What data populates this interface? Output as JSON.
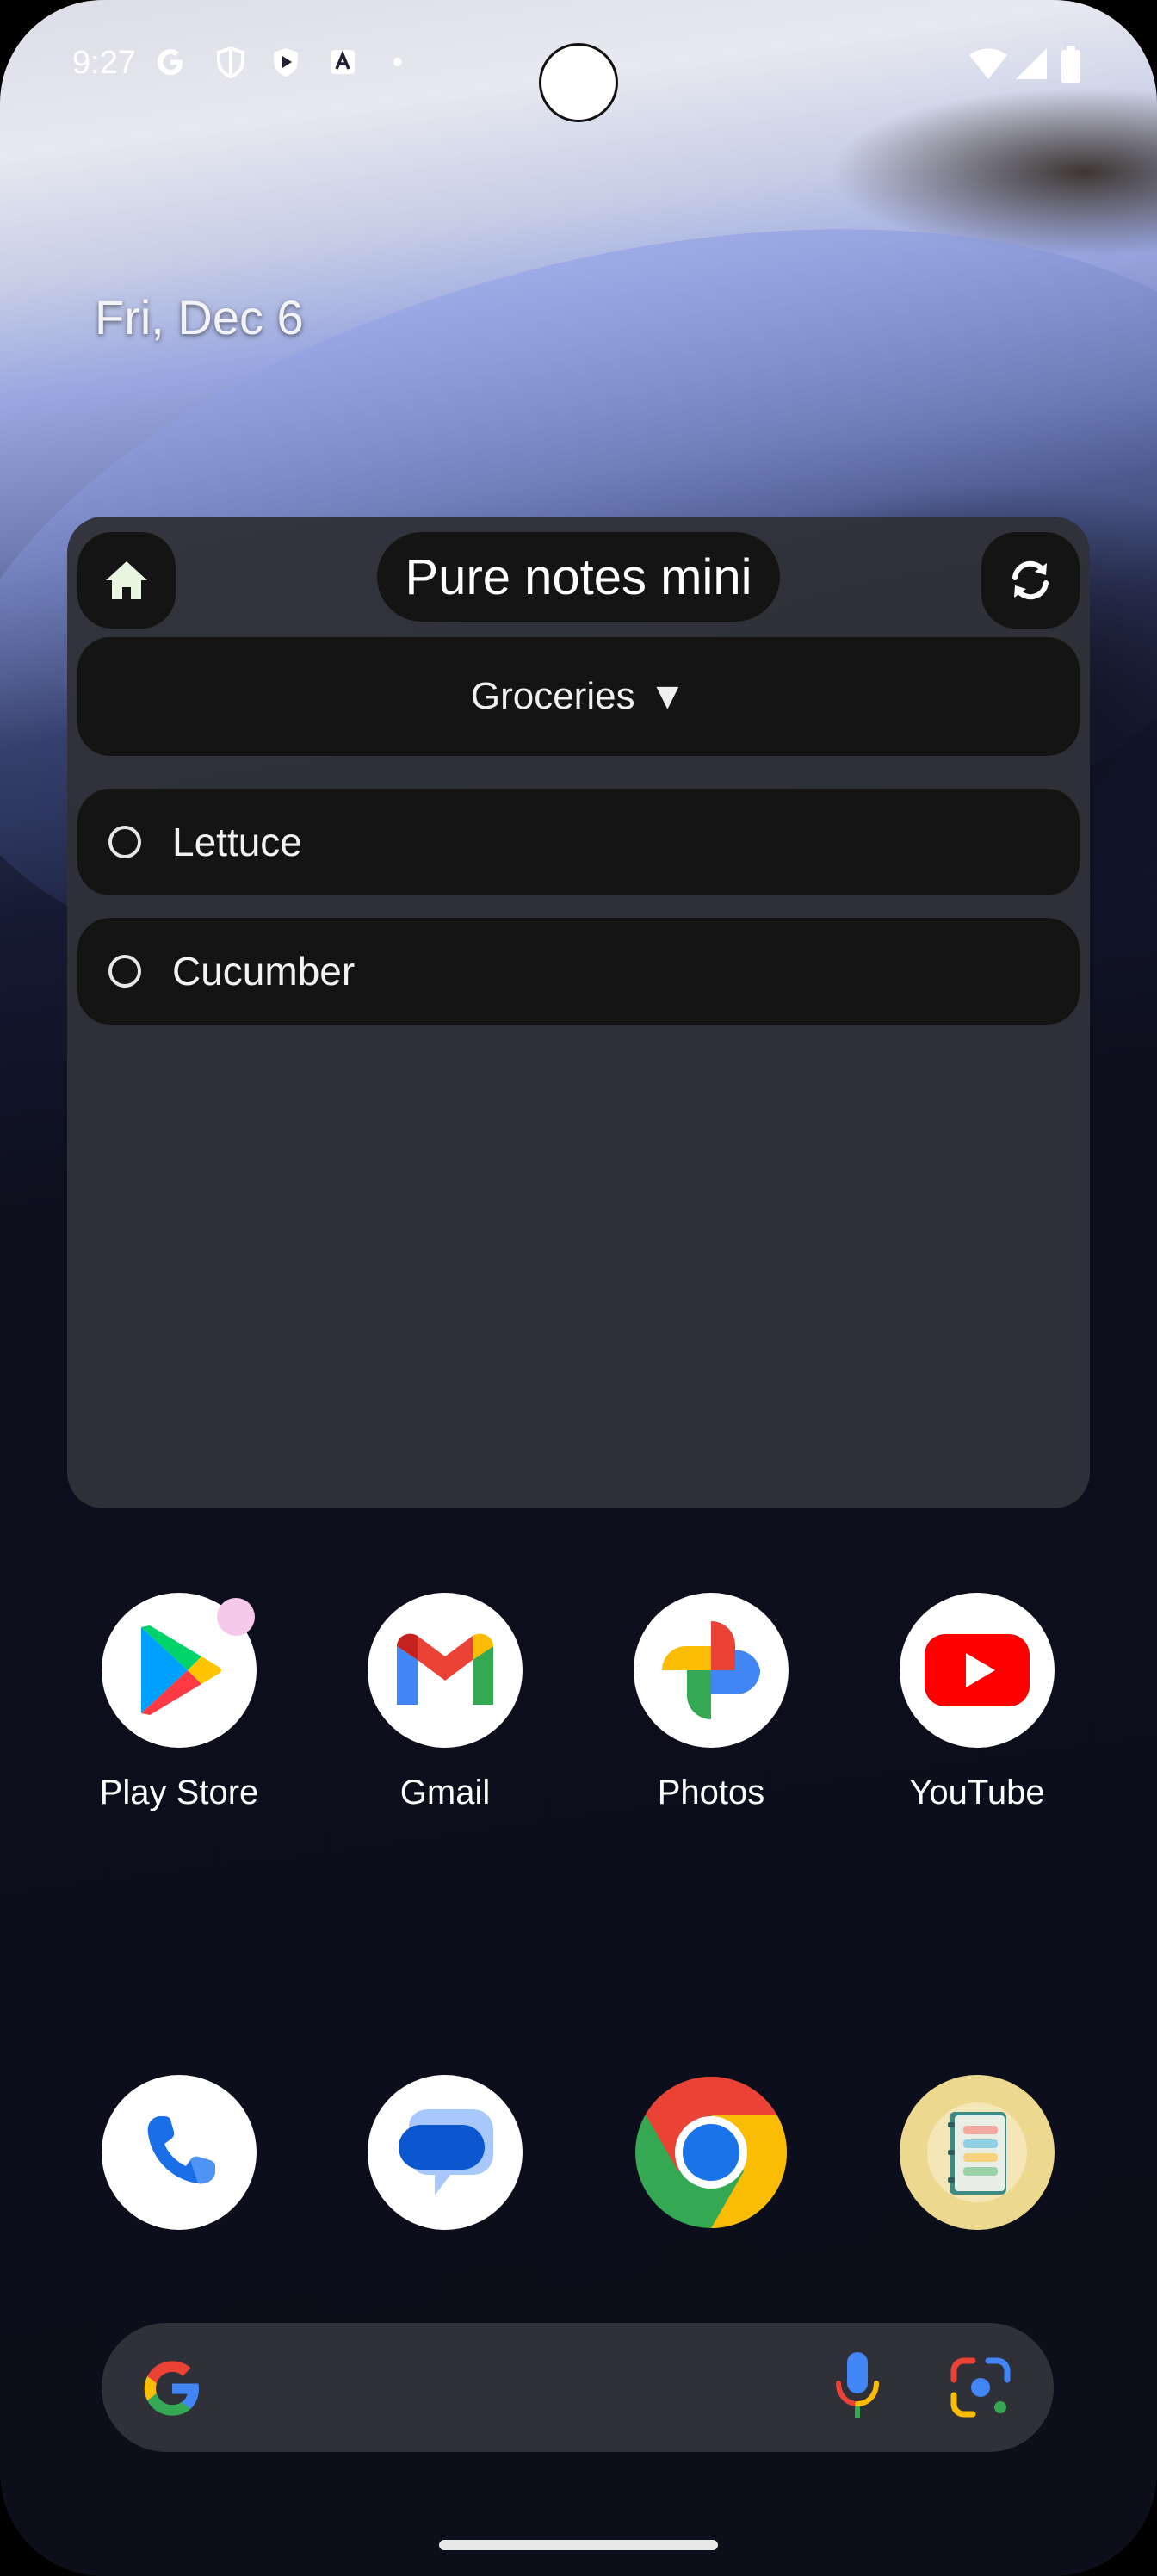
{
  "status_bar": {
    "time": "9:27",
    "left_icons": [
      "google-g-icon",
      "shield-icon",
      "play-protect-icon",
      "translate-a-icon",
      "dot-icon"
    ],
    "right_icons": [
      "wifi-icon",
      "signal-icon",
      "battery-icon"
    ]
  },
  "home": {
    "date": "Fri, Dec 6"
  },
  "widget": {
    "title": "Pure notes mini",
    "list_selector": "Groceries",
    "dropdown_arrow": "▼",
    "items": [
      {
        "label": "Lettuce",
        "checked": false
      },
      {
        "label": "Cucumber",
        "checked": false
      }
    ]
  },
  "apps_row": [
    {
      "label": "Play Store",
      "icon": "play-store-icon"
    },
    {
      "label": "Gmail",
      "icon": "gmail-icon"
    },
    {
      "label": "Photos",
      "icon": "photos-icon"
    },
    {
      "label": "YouTube",
      "icon": "youtube-icon"
    }
  ],
  "dock": [
    {
      "icon": "phone-icon"
    },
    {
      "icon": "messages-icon"
    },
    {
      "icon": "chrome-icon"
    },
    {
      "icon": "notes-app-icon"
    }
  ],
  "search_bar": {
    "icons": [
      "google-g-icon",
      "microphone-icon",
      "google-lens-icon"
    ]
  },
  "colors": {
    "widget_bg": "#303138",
    "widget_button_bg": "#141414",
    "widget_home_icon": "#e8f5e1",
    "badge": "#f6c8ea"
  }
}
